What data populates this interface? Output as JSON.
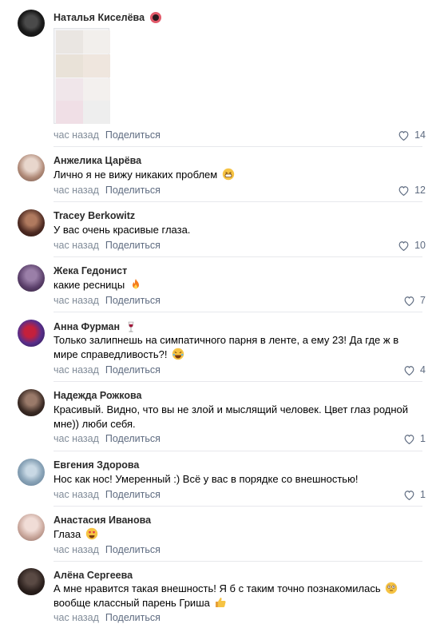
{
  "share_label": "Поделиться",
  "time_label": "час назад",
  "comments": [
    {
      "author": "Наталья Киселёва",
      "badge": "heart-eyes",
      "text": "",
      "has_image": true,
      "likes": "14"
    },
    {
      "author": "Анжелика Царёва",
      "badge": "",
      "text": "Лично я не вижу никаких проблем",
      "emoji": "grin",
      "likes": "12"
    },
    {
      "author": "Tracey Berkowitz",
      "badge": "",
      "text": "У вас очень красивые глаза.",
      "emoji": "",
      "likes": "10"
    },
    {
      "author": "Жека Гедонист",
      "badge": "",
      "text": "какие ресницы",
      "emoji": "fire",
      "likes": "7"
    },
    {
      "author": "Анна Фурман",
      "badge": "wine",
      "text": "Только залипнешь на симпатичного парня в ленте, а ему 23! Да где ж в мире справедливость?!",
      "emoji": "laugh",
      "likes": "4"
    },
    {
      "author": "Надежда Рожкова",
      "badge": "",
      "text": "Красивый. Видно, что вы не злой и мыслящий человек. Цвет глаз родной мне)) люби себя.",
      "emoji": "",
      "likes": "1"
    },
    {
      "author": "Евгения Здорова",
      "badge": "",
      "text": "Нос как нос! Умеренный :) Всё у вас в порядке со внешностью!",
      "emoji": "",
      "likes": "1"
    },
    {
      "author": "Анастасия Иванова",
      "badge": "",
      "text": "Глаза",
      "emoji": "heart-eyes",
      "likes": ""
    },
    {
      "author": "Алёна Сергеева",
      "badge": "",
      "text": "А мне нравится такая внешность! Я б с таким точно познакомилась",
      "text2": "вообще классный парень Гриша",
      "emoji": "flushed",
      "emoji2": "thumbs-up",
      "likes": ""
    }
  ],
  "colors": {
    "meta": "#818c99",
    "share": "#5e6b80",
    "divider": "#e7e8ec"
  }
}
